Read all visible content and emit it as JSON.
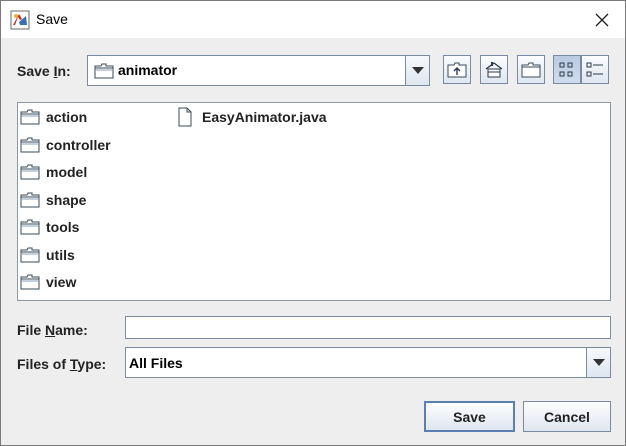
{
  "window": {
    "title": "Save"
  },
  "save_in": {
    "label_pre": "Save ",
    "label_mnemonic": "I",
    "label_post": "n:",
    "value": "animator"
  },
  "toolbar": {
    "buttons": [
      {
        "name": "up-one-level",
        "icon": "folder-up-icon"
      },
      {
        "name": "home",
        "icon": "home-icon"
      },
      {
        "name": "new-folder",
        "icon": "new-folder-icon"
      },
      {
        "name": "list-view",
        "icon": "list-view-icon",
        "pressed": true
      },
      {
        "name": "details-view",
        "icon": "details-view-icon",
        "pressed": false
      }
    ]
  },
  "files": {
    "folders": [
      "action",
      "controller",
      "model",
      "shape",
      "tools",
      "utils",
      "view"
    ],
    "files": [
      "EasyAnimator.java"
    ]
  },
  "file_name": {
    "label_pre": "File ",
    "label_mnemonic": "N",
    "label_post": "ame:",
    "value": ""
  },
  "file_type": {
    "label_pre": "Files of ",
    "label_mnemonic": "T",
    "label_post": "ype:",
    "value": "All Files"
  },
  "actions": {
    "save": "Save",
    "cancel": "Cancel"
  }
}
